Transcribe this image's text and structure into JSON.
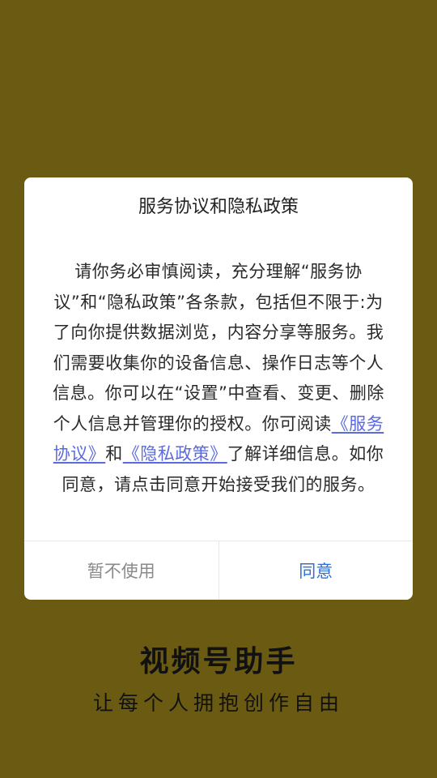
{
  "dialog": {
    "title": "服务协议和隐私政策",
    "body_part1": "请你务必审慎阅读，充分理解“服务协议”和“隐私政策”各条款，包括但不限于:为了向你提供数据浏览，内容分享等服务。我们需要收集你的设备信息、操作日志等个人信息。你可以在“设置”中查看、变更、删除个人信息并管理你的授权。你可阅读",
    "link_service": "《服务协议》",
    "connector": "和",
    "link_privacy": "《隐私政策》",
    "body_part2": "了解详细信息。如你同意，请点击同意开始接受我们的服务。",
    "decline_label": "暂不使用",
    "agree_label": "同意"
  },
  "brand": {
    "title": "视频号助手",
    "slogan": "让每个人拥抱创作自由"
  },
  "colors": {
    "background": "#6a5a12",
    "link": "#5a6adf",
    "agree": "#2f6fd6"
  }
}
